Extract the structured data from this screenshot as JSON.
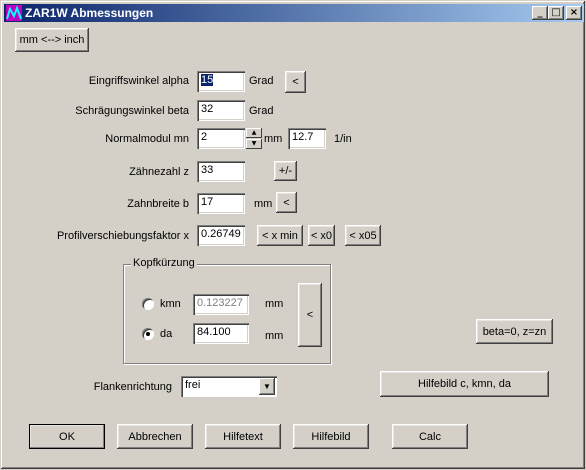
{
  "window": {
    "title": "ZAR1W Abmessungen",
    "minimize": "_",
    "maximize": "□",
    "close": "×"
  },
  "toolbar": {
    "unit_toggle": "mm <--> inch"
  },
  "fields": {
    "eingriffswinkel": {
      "label": "Eingriffswinkel alpha",
      "value": "15",
      "unit": "Grad",
      "button": "<"
    },
    "schraegungswinkel": {
      "label": "Schrägungswinkel beta",
      "value": "32",
      "unit": "Grad"
    },
    "normalmodul": {
      "label": "Normalmodul mn",
      "value": "2",
      "unit": "mm",
      "value_in": "12.7",
      "unit_in": "1/in"
    },
    "zaehnezahl": {
      "label": "Zähnezahl z",
      "value": "33",
      "button": "+/-"
    },
    "zahnbreite": {
      "label": "Zahnbreite b",
      "value": "17",
      "unit": "mm",
      "button": "<"
    },
    "profilverschiebung": {
      "label": "Profilverschiebungsfaktor x",
      "value": "0.26749",
      "buttons": [
        "< x min",
        "< x0",
        "< x05"
      ]
    }
  },
  "kopfkuerzung": {
    "title": "Kopfkürzung",
    "kmn": {
      "label": "kmn",
      "value": "0.123227",
      "unit": "mm",
      "checked": false
    },
    "da": {
      "label": "da",
      "value": "84.100",
      "unit": "mm",
      "checked": true
    },
    "apply_button": "<"
  },
  "beta_button": "beta=0, z=zn",
  "flankenrichtung": {
    "label": "Flankenrichtung",
    "selected": "frei"
  },
  "hilfebild_ckmn": "Hilfebild c, kmn, da",
  "footer": {
    "ok": "OK",
    "abbrechen": "Abbrechen",
    "hilfetext": "Hilfetext",
    "hilfebild": "Hilfebild",
    "calc": "Calc"
  },
  "colors": {
    "titlebar_start": "#0a246a",
    "titlebar_end": "#a6caf0",
    "face": "#d4d0c8"
  }
}
